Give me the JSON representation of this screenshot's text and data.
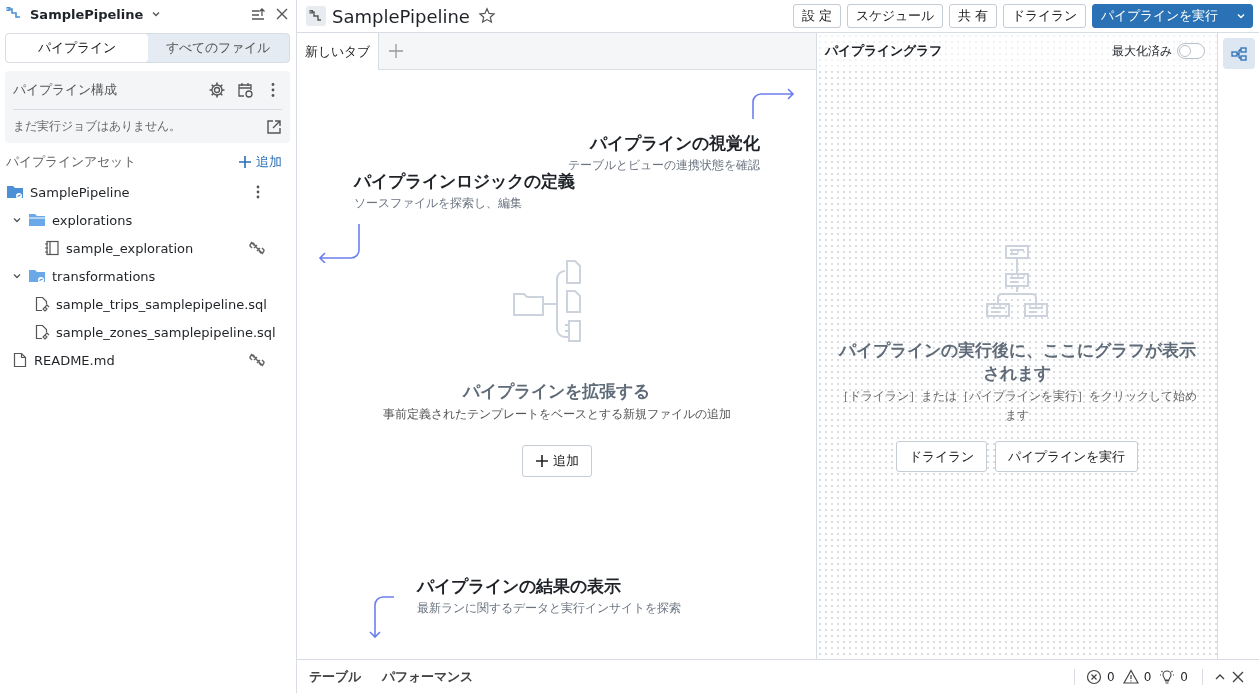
{
  "sidebar": {
    "title": "SamplePipeline",
    "tabs": [
      {
        "label": "パイプライン",
        "selected": true
      },
      {
        "label": "すべてのファイル",
        "selected": false
      }
    ],
    "config": {
      "title": "パイプライン構成",
      "message": "まだ実行ジョブはありません。"
    },
    "assets": {
      "title": "パイプラインアセット",
      "add_label": "追加"
    },
    "tree": [
      {
        "name": "SamplePipeline",
        "kind": "pipeline-folder",
        "children": [
          {
            "name": "explorations",
            "kind": "folder",
            "expanded": true,
            "children": [
              {
                "name": "sample_exploration",
                "kind": "notebook",
                "unlinked": true
              }
            ]
          },
          {
            "name": "transformations",
            "kind": "linked-folder",
            "expanded": true,
            "children": [
              {
                "name": "sample_trips_samplepipeline.sql",
                "kind": "sql",
                "unlinked": false
              },
              {
                "name": "sample_zones_samplepipeline.sql",
                "kind": "sql",
                "unlinked": false
              }
            ]
          },
          {
            "name": "README.md",
            "kind": "file",
            "unlinked": true
          }
        ]
      }
    ]
  },
  "header": {
    "title": "SamplePipeline",
    "starred": false,
    "buttons": [
      {
        "label": "設 定",
        "kind": "default"
      },
      {
        "label": "スケジュール",
        "kind": "default"
      },
      {
        "label": "共 有",
        "kind": "default"
      },
      {
        "label": "ドライラン",
        "kind": "default"
      },
      {
        "label": "パイプラインを実行",
        "kind": "primary"
      }
    ]
  },
  "editor": {
    "tabs": [
      {
        "label": "新しいタブ",
        "selected": true
      }
    ],
    "hints": [
      {
        "kind": "visualize",
        "title": "パイプラインの視覚化",
        "subtitle": "テーブルとビューの連携状態を確認"
      },
      {
        "kind": "define",
        "title": "パイプラインロジックの定義",
        "subtitle": "ソースファイルを探索し、編集"
      },
      {
        "kind": "results",
        "title": "パイプラインの結果の表示",
        "subtitle": "最新ランに関するデータと実行インサイトを探索"
      }
    ],
    "empty": {
      "title": "パイプラインを拡張する",
      "subtitle": "事前定義されたテンプレートをベースとする新規ファイルの追加",
      "add_label": "追加"
    }
  },
  "graph": {
    "title": "パイプライングラフ",
    "toggle": {
      "label": "最大化済み",
      "on": false
    },
    "empty": {
      "title": "パイプラインの実行後に、ここにグラフが表示されます",
      "subtitle": "［ドライラン］または［パイプラインを実行］をクリックして始めます",
      "buttons": [
        "ドライラン",
        "パイプラインを実行"
      ]
    }
  },
  "bottom": {
    "tabs": [
      "テーブル",
      "パフォーマンス"
    ],
    "errors": "0",
    "warnings": "0",
    "hints": "0"
  }
}
